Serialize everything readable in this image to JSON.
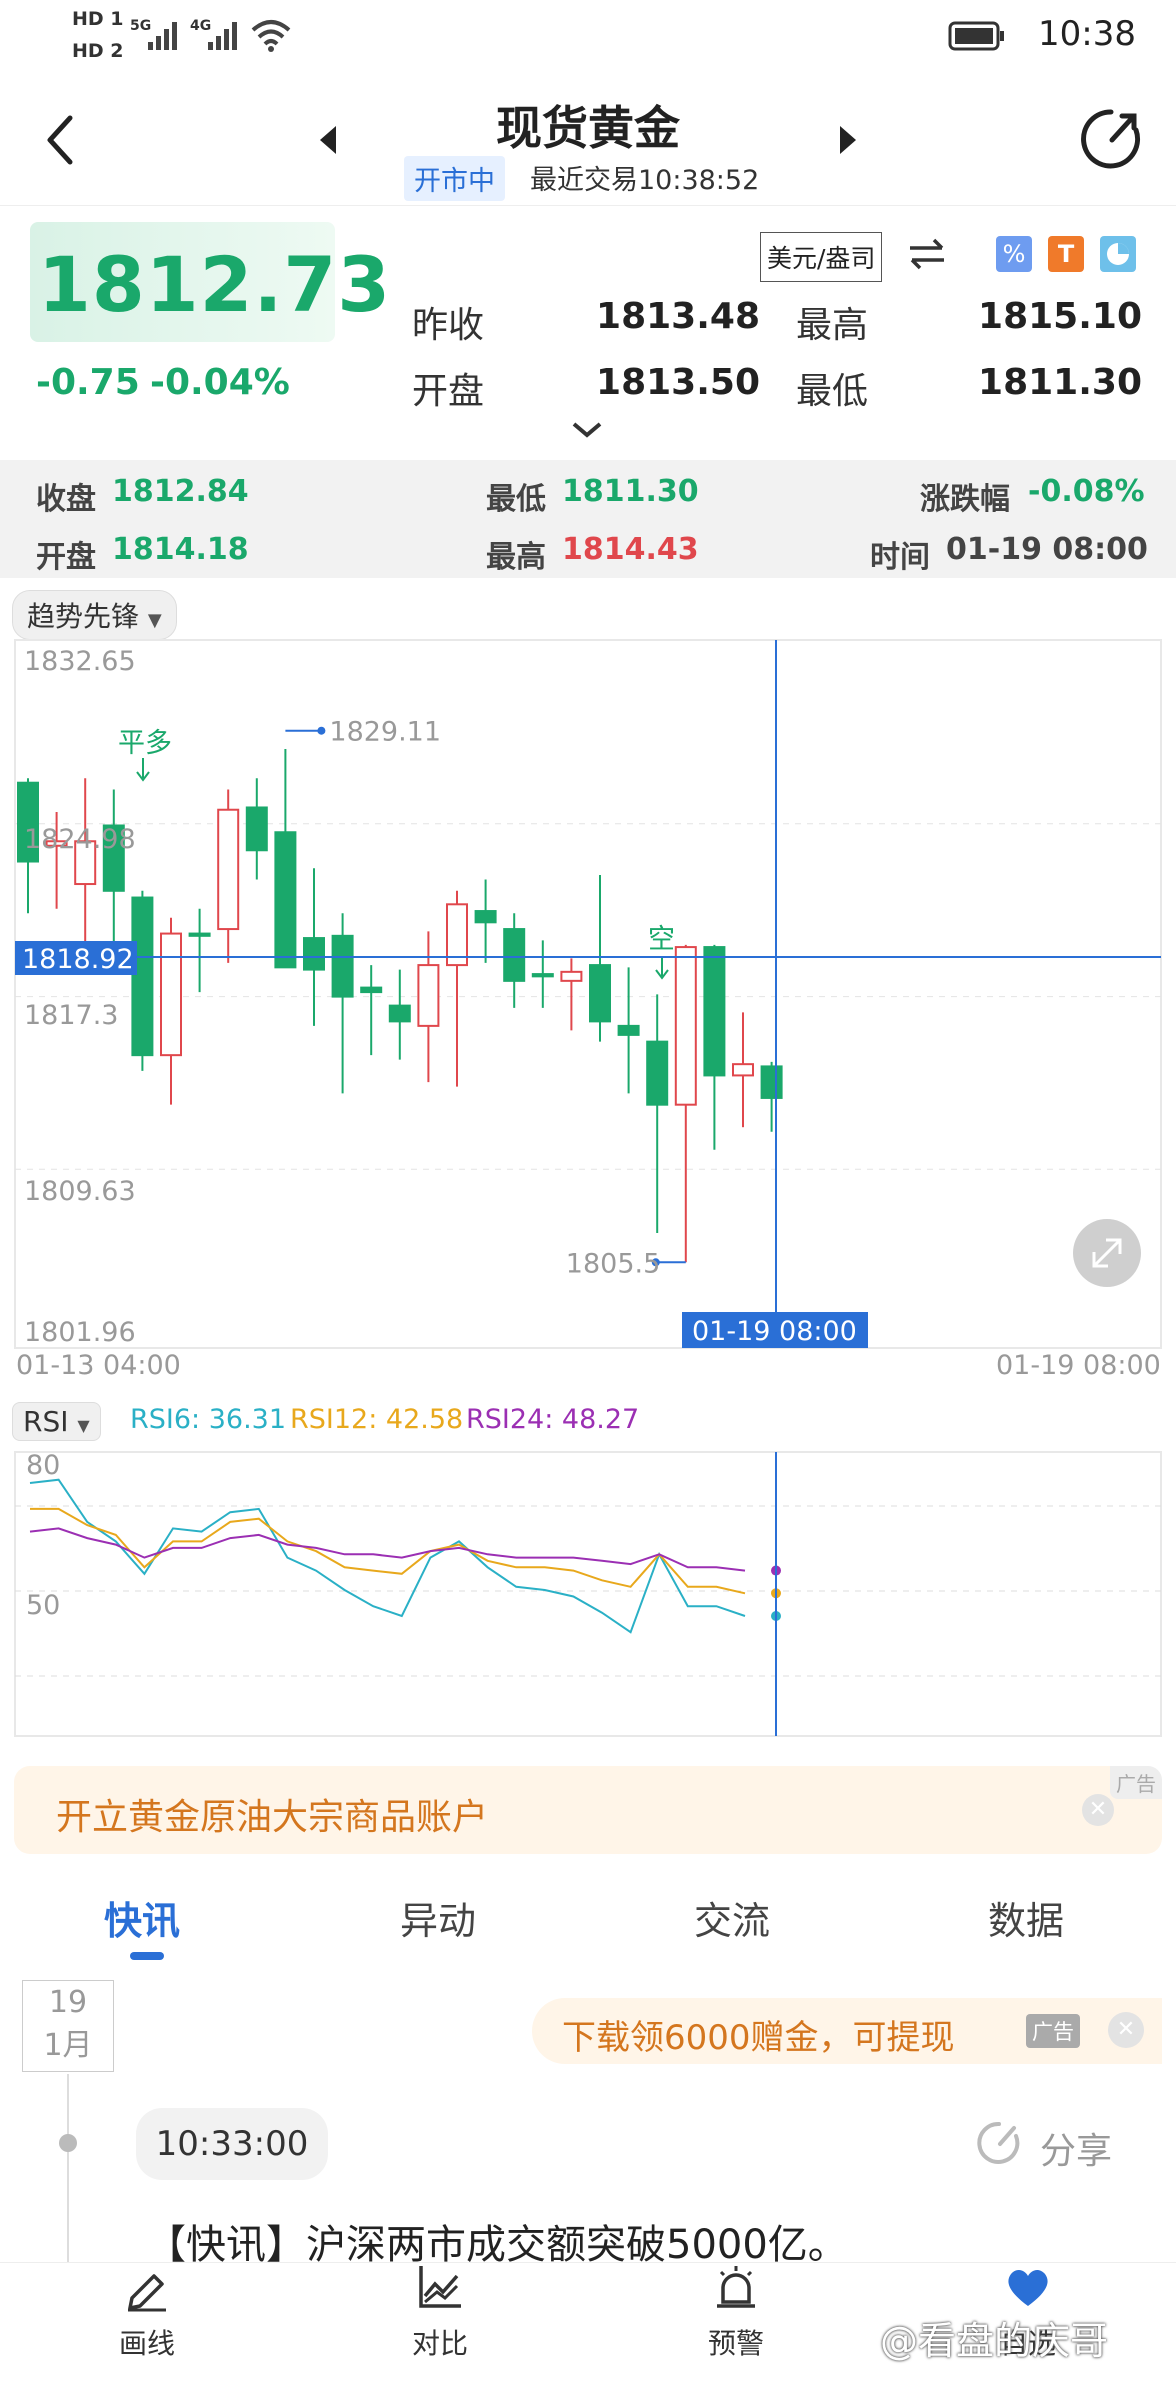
{
  "status_bar": {
    "sim1": "HD 1",
    "sim2": "HD 2",
    "net1": "5G",
    "net2": "4G",
    "time": "10:38"
  },
  "header": {
    "title": "现货黄金",
    "market_status": "开市中",
    "last_trade": "最近交易10:38:52"
  },
  "quote": {
    "price": "1812.73",
    "change": "-0.75",
    "change_pct": "-0.04%",
    "unit": "美元/盎司",
    "prev_close_label": "昨收",
    "prev_close": "1813.48",
    "high_label": "最高",
    "high": "1815.10",
    "open_label": "开盘",
    "open": "1813.50",
    "low_label": "最低",
    "low": "1811.30"
  },
  "candle_info": {
    "close_label": "收盘",
    "close": "1812.84",
    "low_label": "最低",
    "low": "1811.30",
    "chg_label": "涨跌幅",
    "chg": "-0.08%",
    "open_label": "开盘",
    "open": "1814.18",
    "high_label": "最高",
    "high": "1814.43",
    "time_label": "时间",
    "time": "01-19 08:00"
  },
  "indicator_selector": "趋势先锋",
  "rsi_selector": "RSI",
  "rsi": {
    "rsi6_label": "RSI6: 36.31",
    "rsi12_label": "RSI12: 42.58",
    "rsi24_label": "RSI24: 48.27",
    "rsi6_color": "#2ab0c6",
    "rsi12_color": "#e8a81c",
    "rsi24_color": "#9b2fb3",
    "ticks": [
      "80",
      "50"
    ]
  },
  "chart_data": {
    "type": "candlestick",
    "y_ticks": [
      "1832.65",
      "1824.98",
      "1817.3",
      "1809.63",
      "1801.96"
    ],
    "x_start": "01-13 04:00",
    "x_end": "01-19 08:00",
    "crosshair_price": "1818.92",
    "crosshair_time": "01-19 08:00",
    "max_label": "1829.11",
    "min_label": "1805.5",
    "signal_long": "平多",
    "signal_short": "空",
    "ylim": [
      1801.96,
      1832.65
    ],
    "candles": [
      {
        "o": 1826.8,
        "c": 1823.3,
        "h": 1827.0,
        "l": 1821.0
      },
      {
        "o": 1824.0,
        "c": 1824.2,
        "h": 1825.5,
        "l": 1821.2
      },
      {
        "o": 1822.3,
        "c": 1824.2,
        "h": 1827.0,
        "l": 1818.8
      },
      {
        "o": 1824.9,
        "c": 1822.0,
        "h": 1826.5,
        "l": 1819.5
      },
      {
        "o": 1821.7,
        "c": 1814.7,
        "h": 1822.0,
        "l": 1814.0
      },
      {
        "o": 1814.7,
        "c": 1820.1,
        "h": 1820.8,
        "l": 1812.5
      },
      {
        "o": 1820.1,
        "c": 1820.0,
        "h": 1821.2,
        "l": 1817.5
      },
      {
        "o": 1820.3,
        "c": 1825.6,
        "h": 1826.5,
        "l": 1818.8
      },
      {
        "o": 1825.7,
        "c": 1823.8,
        "h": 1827.0,
        "l": 1822.5
      },
      {
        "o": 1824.6,
        "c": 1818.6,
        "h": 1828.3,
        "l": 1818.8
      },
      {
        "o": 1819.9,
        "c": 1818.5,
        "h": 1823.0,
        "l": 1816.0
      },
      {
        "o": 1820.0,
        "c": 1817.3,
        "h": 1821.0,
        "l": 1813.0
      },
      {
        "o": 1817.7,
        "c": 1817.5,
        "h": 1818.7,
        "l": 1814.7
      },
      {
        "o": 1816.9,
        "c": 1816.2,
        "h": 1818.5,
        "l": 1814.5
      },
      {
        "o": 1816.0,
        "c": 1818.7,
        "h": 1820.2,
        "l": 1813.5
      },
      {
        "o": 1818.7,
        "c": 1821.4,
        "h": 1822.0,
        "l": 1813.3
      },
      {
        "o": 1821.1,
        "c": 1820.6,
        "h": 1822.5,
        "l": 1818.8
      },
      {
        "o": 1820.3,
        "c": 1818.0,
        "h": 1821.0,
        "l": 1816.8
      },
      {
        "o": 1818.3,
        "c": 1818.2,
        "h": 1819.8,
        "l": 1816.8
      },
      {
        "o": 1818.0,
        "c": 1818.4,
        "h": 1819.0,
        "l": 1815.8
      },
      {
        "o": 1818.7,
        "c": 1816.2,
        "h": 1822.7,
        "l": 1815.3
      },
      {
        "o": 1816.0,
        "c": 1815.6,
        "h": 1818.6,
        "l": 1813.0
      },
      {
        "o": 1815.3,
        "c": 1812.5,
        "h": 1817.4,
        "l": 1806.8
      },
      {
        "o": 1812.5,
        "c": 1819.5,
        "h": 1819.6,
        "l": 1805.5
      },
      {
        "o": 1819.5,
        "c": 1813.8,
        "h": 1819.6,
        "l": 1810.5
      },
      {
        "o": 1813.8,
        "c": 1814.3,
        "h": 1816.6,
        "l": 1811.5
      },
      {
        "o": 1814.2,
        "c": 1812.8,
        "h": 1814.4,
        "l": 1811.3
      }
    ],
    "rsi6": [
      78,
      79,
      66,
      60,
      50,
      64,
      63,
      69,
      70,
      55,
      51,
      45,
      40,
      37,
      55,
      60,
      52,
      46,
      45,
      43,
      38,
      32,
      56,
      40,
      40,
      37
    ],
    "rsi12": [
      70,
      70,
      65,
      62,
      52,
      60,
      60,
      66,
      67,
      60,
      57,
      52,
      51,
      50,
      57,
      59,
      54,
      52,
      52,
      51,
      48,
      46,
      56,
      46,
      46,
      44
    ],
    "rsi24": [
      63,
      64,
      61,
      59,
      55,
      58,
      58,
      61,
      62,
      59,
      58,
      56,
      56,
      55,
      57,
      58,
      56,
      55,
      55,
      55,
      54,
      53,
      56,
      52,
      52,
      51
    ]
  },
  "ads": {
    "banner": "开立黄金原油大宗商品账户",
    "banner_tag": "广告",
    "news_ad": "下载领6000赠金，可提现",
    "news_ad_tag": "广告"
  },
  "tabs": [
    "快讯",
    "异动",
    "交流",
    "数据"
  ],
  "feed": {
    "day": "19",
    "month": "1月",
    "time": "10:33:00",
    "share": "分享",
    "headline": "【快讯】沪深两市成交额突破5000亿。"
  },
  "bottom_nav": [
    {
      "label": "画线",
      "icon": "draw-line-icon"
    },
    {
      "label": "对比",
      "icon": "compare-chart-icon"
    },
    {
      "label": "预警",
      "icon": "alarm-icon"
    },
    {
      "label": "自选",
      "icon": "favorite-heart-icon"
    }
  ],
  "watermark": "@看盘的庆哥"
}
